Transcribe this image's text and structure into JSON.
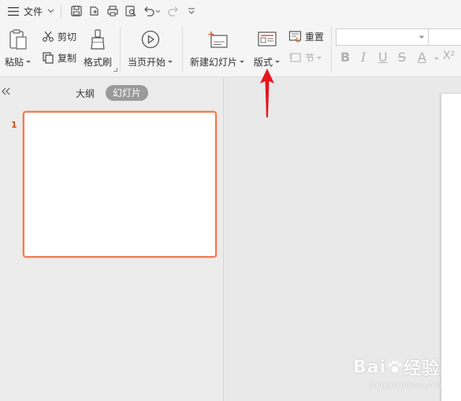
{
  "quickbar": {
    "menu_label": "文件"
  },
  "ribbon": {
    "paste_label": "粘贴",
    "cut_label": "剪切",
    "copy_label": "复制",
    "format_painter_label": "格式刷",
    "play_from_current_label": "当页开始",
    "new_slide_label": "新建幻灯片",
    "layout_label": "版式",
    "reset_label": "重置",
    "section_label": "节",
    "font_name_value": "",
    "font_size_value": "",
    "format_buttons": [
      "B",
      "I",
      "U",
      "S",
      "A",
      "X²"
    ]
  },
  "leftpane": {
    "tab_outline": "大纲",
    "tab_slides": "幻灯片",
    "slide_number": "1"
  },
  "watermark": {
    "brand_left": "Bai",
    "brand_right": "经验",
    "url": "jingyan.baidu.com"
  },
  "colors": {
    "accent_orange": "#f07b57",
    "arrow_red": "#e8141c"
  }
}
